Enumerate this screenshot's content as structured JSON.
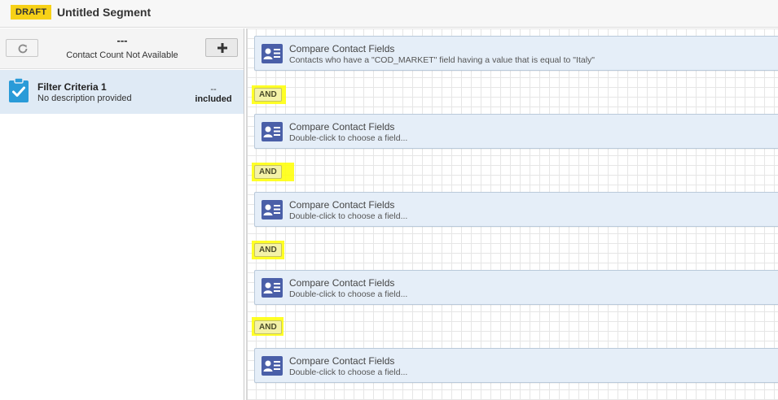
{
  "header": {
    "badge": "DRAFT",
    "title": "Untitled Segment"
  },
  "left_panel": {
    "count_value": "---",
    "count_label": "Contact Count Not Available",
    "refresh_icon": "refresh-icon",
    "add_icon": "plus-icon",
    "criteria": {
      "name": "Filter Criteria 1",
      "description": "No description provided",
      "count": "--",
      "included": "included",
      "icon": "clipboard-check-icon"
    }
  },
  "canvas": {
    "filters": [
      {
        "title": "Compare Contact Fields",
        "description": "Contacts who have a \"COD_MARKET\" field having a value that is equal to \"Italy\"",
        "icon": "contact-card-icon"
      },
      {
        "title": "Compare Contact Fields",
        "description": "Double-click to choose a field...",
        "icon": "contact-card-icon"
      },
      {
        "title": "Compare Contact Fields",
        "description": "Double-click to choose a field...",
        "icon": "contact-card-icon"
      },
      {
        "title": "Compare Contact Fields",
        "description": "Double-click to choose a field...",
        "icon": "contact-card-icon"
      },
      {
        "title": "Compare Contact Fields",
        "description": "Double-click to choose a field...",
        "icon": "contact-card-icon"
      }
    ],
    "operators": [
      "AND",
      "AND",
      "AND",
      "AND"
    ]
  },
  "colors": {
    "draft_badge": "#f7d117",
    "selected_criteria_bg": "#dfeaf5",
    "card_bg": "#e5eef8",
    "icon_blue": "#4a5fa8",
    "highlight": "#ffff00"
  }
}
